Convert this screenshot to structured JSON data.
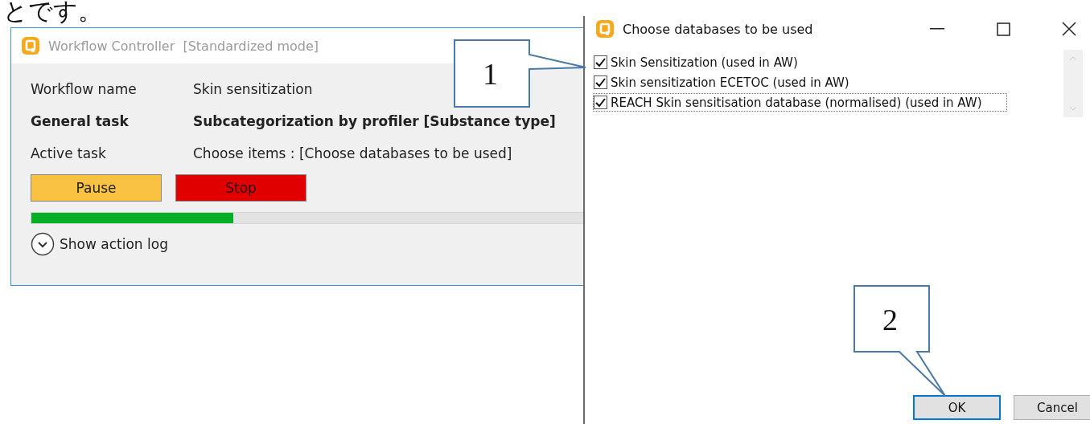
{
  "caption": {
    "text": "とです。"
  },
  "workflow_window": {
    "title": "Workflow Controller",
    "mode": "[Standardized mode]",
    "fields": [
      {
        "label": "Workflow name",
        "value": "Skin sensitization",
        "bold": false
      },
      {
        "label": "General task",
        "value": "Subcategorization by profiler [Substance type]",
        "bold": true
      },
      {
        "label": "Active task",
        "value": "Choose items : [Choose databases to be used]",
        "bold": false
      }
    ],
    "buttons": [
      {
        "label": "Pause",
        "kind": "pause"
      },
      {
        "label": "Stop",
        "kind": "stop"
      }
    ],
    "progress": {
      "level": 0.36
    },
    "log_toggle": {
      "label": "Show action log",
      "expanded": false
    }
  },
  "dialog": {
    "title": "Choose databases to be used",
    "items": [
      {
        "label": "Skin Sensitization (used in AW)",
        "checked": true,
        "focused": false
      },
      {
        "label": "Skin sensitization ECETOC (used in AW)",
        "checked": true,
        "focused": false
      },
      {
        "label": "REACH Skin sensitisation database (normalised) (used in AW)",
        "checked": true,
        "focused": true
      }
    ],
    "buttons": [
      {
        "label": "OK",
        "default": true
      },
      {
        "label": "Cancel",
        "default": false
      }
    ]
  },
  "callouts": [
    {
      "number": "1"
    },
    {
      "number": "2"
    }
  ]
}
